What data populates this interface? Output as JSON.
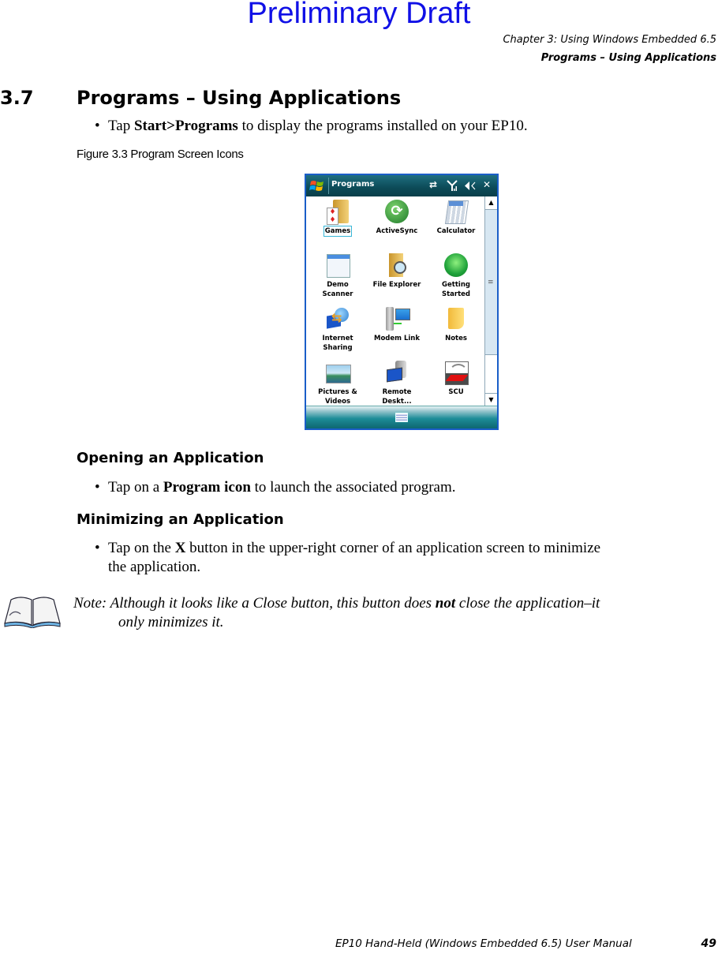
{
  "watermark": "Preliminary Draft",
  "header": {
    "chapter": "Chapter 3:  Using Windows Embedded 6.5",
    "section": "Programs – Using Applications"
  },
  "section": {
    "number": "3.7",
    "title": "Programs – Using Applications"
  },
  "intro_bullet": {
    "pre": "Tap ",
    "bold1": "Start",
    "sep": ">",
    "bold2": "Programs",
    "post": " to display the programs installed on your EP10."
  },
  "figure_caption": "Figure 3.3  Program Screen Icons",
  "device": {
    "window_title": "Programs",
    "status_icons": [
      "sync-icon",
      "signal-icon",
      "volume-icon",
      "close-icon"
    ],
    "close_glyph": "✕",
    "apps": [
      {
        "label": "Games",
        "icon": "games-folder-icon",
        "selected": true
      },
      {
        "label": "ActiveSync",
        "icon": "activesync-icon"
      },
      {
        "label": "Calculator",
        "icon": "calculator-icon"
      },
      {
        "label": "Demo\nScanner",
        "l1": "Demo",
        "l2": "Scanner",
        "icon": "demo-scanner-icon"
      },
      {
        "label": "File Explorer",
        "icon": "file-explorer-icon"
      },
      {
        "label": "Getting\nStarted",
        "l1": "Getting",
        "l2": "Started",
        "icon": "getting-started-icon"
      },
      {
        "label": "Internet\nSharing",
        "l1": "Internet",
        "l2": "Sharing",
        "icon": "internet-sharing-icon"
      },
      {
        "label": "Modem Link",
        "icon": "modem-link-icon"
      },
      {
        "label": "Notes",
        "icon": "notes-icon"
      },
      {
        "label": "Pictures &\nVideos",
        "l1": "Pictures &",
        "l2": "Videos",
        "icon": "pictures-videos-icon"
      },
      {
        "label": "Remote\nDeskt...",
        "l1": "Remote",
        "l2": "Deskt...",
        "icon": "remote-desktop-icon"
      },
      {
        "label": "SCU",
        "icon": "scu-icon"
      }
    ]
  },
  "opening": {
    "heading": "Opening an Application",
    "pre": "Tap on a ",
    "bold": "Program icon",
    "post": " to launch the associated program."
  },
  "minimizing": {
    "heading": "Minimizing an Application",
    "pre": "Tap on the ",
    "bold": "X",
    "post": " button in the upper-right corner of an application screen to minimize",
    "line2": "the application."
  },
  "note": {
    "pre": "Note: Although it looks like a Close button, this button does ",
    "bold": "not",
    "post": " close the application–it",
    "line2": "only minimizes it."
  },
  "footer": {
    "manual": "EP10 Hand-Held (Windows Embedded 6.5) User Manual",
    "page": "49"
  }
}
